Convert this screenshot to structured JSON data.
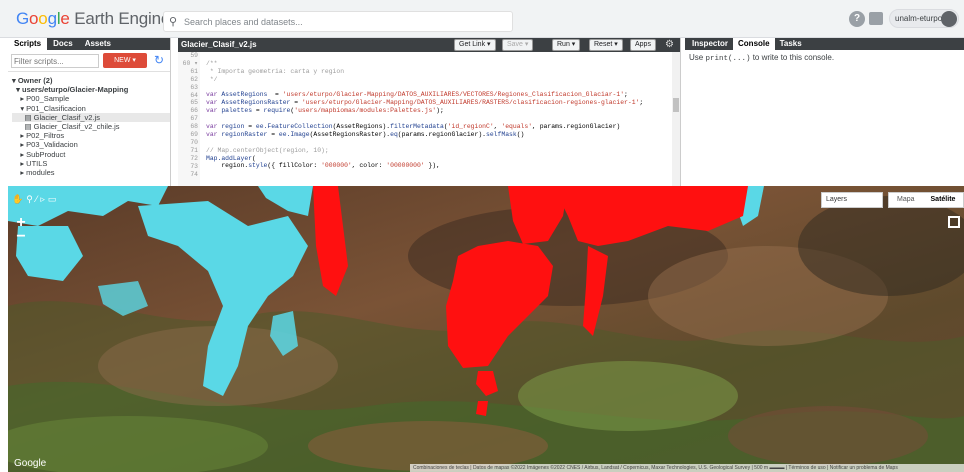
{
  "header": {
    "logo_letters": [
      "G",
      "o",
      "o",
      "g",
      "l",
      "e"
    ],
    "logo_rest": " Earth Engine",
    "search_placeholder": "Search places and datasets...",
    "help": "?",
    "user": "unalm-eturpo"
  },
  "left_panel": {
    "tabs": [
      "Scripts",
      "Docs",
      "Assets"
    ],
    "filter_placeholder": "Filter scripts...",
    "new_button": "NEW ▾",
    "tree": [
      "▾ Owner (2)",
      "  ▾ users/eturpo/Glacier-Mapping",
      "    ▸ P00_Sample",
      "    ▾ P01_Clasificacion",
      "      ▤ Glacier_Clasif_v2.js",
      "      ▤ Glacier_Clasif_v2_chile.js",
      "    ▸ P02_Filtros",
      "    ▸ P03_Validacion",
      "    ▸ SubProduct",
      "    ▸ UTILS",
      "    ▸ modules"
    ]
  },
  "editor": {
    "title": "Glacier_Clasif_v2.js",
    "buttons": {
      "get_link": "Get Link ▾",
      "save": "Save ▾",
      "run": "Run ▾",
      "reset": "Reset ▾",
      "apps": "Apps"
    },
    "line_numbers": [
      "59",
      "60 ▾",
      "61",
      "62",
      "63",
      "64",
      "65",
      "66",
      "67",
      "68",
      "69",
      "70",
      "71",
      "72",
      "73",
      "74"
    ]
  },
  "right_panel": {
    "tabs": [
      "Inspector",
      "Console",
      "Tasks"
    ],
    "console_pre": "Use ",
    "console_code": "print(...)",
    "console_post": " to write to this console."
  },
  "map": {
    "tools": [
      "✋",
      "⚲",
      "⁄",
      "▹",
      "▭"
    ],
    "zoom_in": "+",
    "zoom_out": "−",
    "layers_label": "Layers",
    "maptype": [
      "Mapa",
      "Satélite"
    ],
    "watermark": "Google",
    "attribution": "Combinaciones de teclas | Datos de mapas ©2022 Imágenes ©2022 CNES / Airbus, Landsat / Copernicus, Maxar Technologies, U.S. Geological Survey | 500 m ▬▬▬ | Términos de uso | Notificar un problema de Maps"
  }
}
